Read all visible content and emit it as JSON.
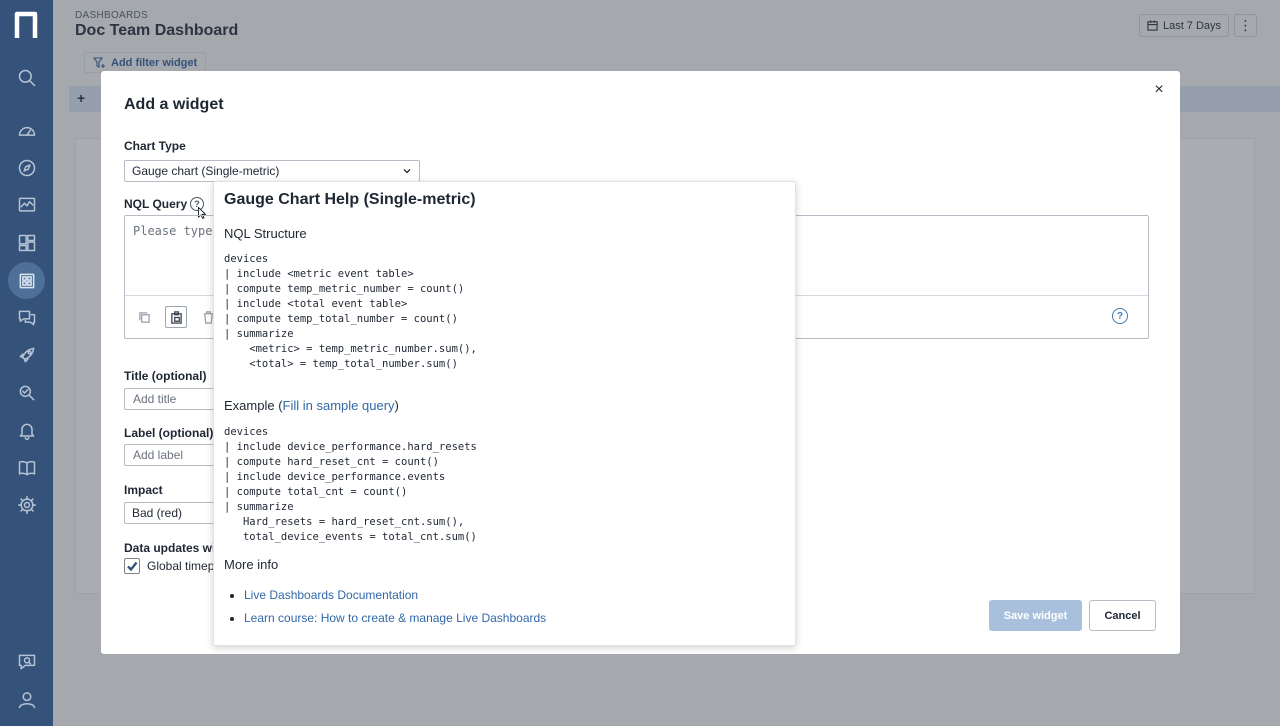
{
  "page": {
    "breadcrumb": "DASHBOARDS",
    "title": "Doc Team Dashboard",
    "date_range": "Last 7 Days",
    "add_filter": "Add filter widget",
    "add_tab": "+"
  },
  "sidebar": {
    "icons": [
      "logo-icon",
      "search-icon",
      "speedometer-icon",
      "compass-icon",
      "monitor-chart-icon",
      "dashboard-grid-icon",
      "live-dashboards-icon",
      "chat-bubbles-icon",
      "rocket-icon",
      "workflow-search-icon",
      "bell-icon",
      "book-icon",
      "gear-icon",
      "feedback-icon",
      "user-icon"
    ],
    "active": "live-dashboards-icon"
  },
  "modal": {
    "title": "Add a widget",
    "close": "×",
    "chart_type_label": "Chart Type",
    "chart_type_value": "Gauge chart (Single-metric)",
    "nql_label": "NQL Query",
    "nql_help": "?",
    "query_placeholder": "Please type your NQL query here",
    "title_label": "Title (optional)",
    "title_placeholder": "Add title",
    "label_label": "Label (optional)",
    "label_placeholder": "Add label",
    "impact_label": "Impact",
    "impact_value": "Bad (red)",
    "updates_label": "Data updates with",
    "global_checkbox_label": "Global timeperiod",
    "global_checked": true,
    "save_label": "Save widget",
    "cancel_label": "Cancel",
    "query_help_icon": "?"
  },
  "help": {
    "title": "Gauge Chart Help (Single-metric)",
    "structure_heading": "NQL Structure",
    "structure_code": "devices\n| include <metric event table>\n| compute temp_metric_number = count()\n| include <total event table>\n| compute temp_total_number = count()\n| summarize\n    <metric> = temp_metric_number.sum(),\n    <total> = temp_total_number.sum()",
    "example_prefix": "Example (",
    "example_link": "Fill in sample query",
    "example_suffix": ")",
    "example_code": "devices\n| include device_performance.hard_resets\n| compute hard_reset_cnt = count()\n| include device_performance.events\n| compute total_cnt = count()\n| summarize\n   Hard_resets = hard_reset_cnt.sum(),\n   total_device_events = total_cnt.sum()",
    "more_info_heading": "More info",
    "links": [
      "Live Dashboards Documentation",
      "Learn course: How to create & manage Live Dashboards"
    ]
  }
}
